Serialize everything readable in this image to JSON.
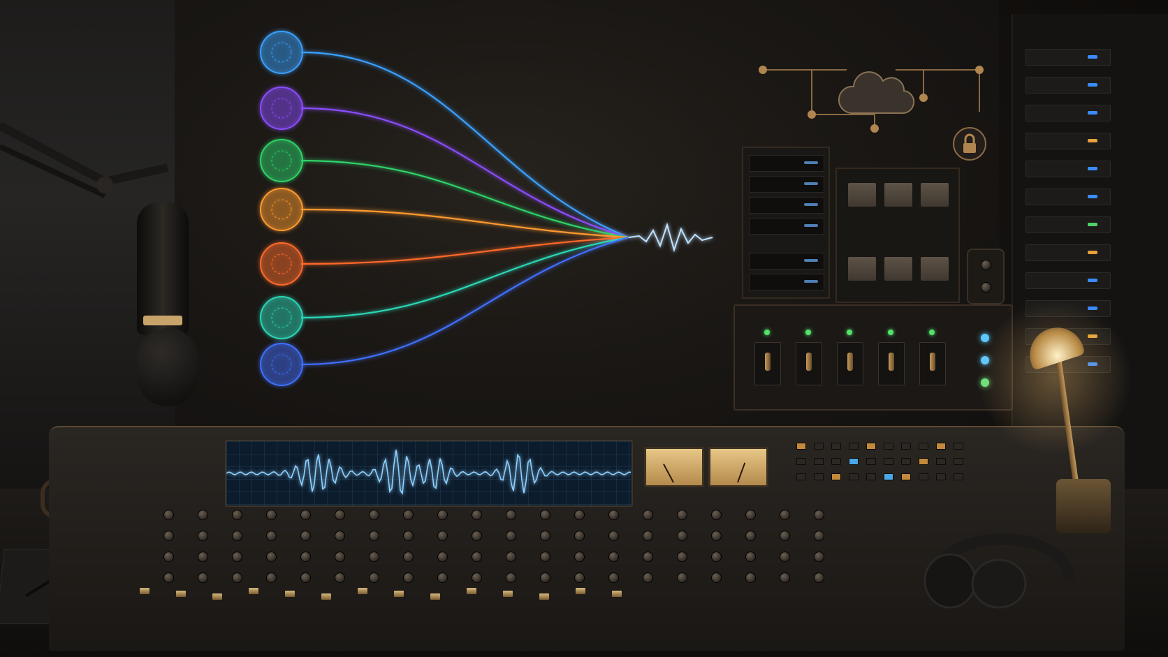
{
  "scene": {
    "palette": {
      "wall": "#1a1714",
      "brass": "#c49a5c",
      "screen_wave": "#7fc4ff",
      "beam": "#4aa3ff"
    },
    "data_streams": [
      {
        "icon": "network-orb-icon",
        "color": "#3aa0ff"
      },
      {
        "icon": "wave-orb-icon",
        "color": "#8a4dff"
      },
      {
        "icon": "circuit-orb-icon",
        "color": "#2fd36a"
      },
      {
        "icon": "polyhedron-orb-icon",
        "color": "#ff9a2e"
      },
      {
        "icon": "mesh-orb-icon",
        "color": "#ff6a2a"
      },
      {
        "icon": "particle-orb-icon",
        "color": "#2cd6b6"
      },
      {
        "icon": "spiral-orb-icon",
        "color": "#3f6fff"
      }
    ],
    "icons": [
      "cloud-icon",
      "lock-icon",
      "folder-icon",
      "microphone-icon",
      "headphones-icon",
      "desk-lamp-icon",
      "coffee-mug-icon"
    ]
  }
}
